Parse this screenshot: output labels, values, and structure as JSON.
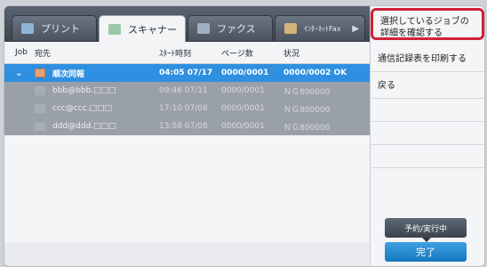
{
  "tabs": [
    {
      "label": "プリント"
    },
    {
      "label": "スキャナー"
    },
    {
      "label": "ファクス"
    },
    {
      "label": "ｲﾝﾀｰﾈｯﾄFax"
    }
  ],
  "table": {
    "headers": {
      "job": "Job",
      "dest": "宛先",
      "time": "ｽﾀｰﾄ時刻",
      "pages": "ページ数",
      "status": "状況"
    },
    "rows": [
      {
        "dest": "順次同報",
        "time": "04:05 07/17",
        "pages": "0000/0001",
        "status": "0000/0002 OK"
      },
      {
        "dest": "bbb@bbb.□□□",
        "time": "09:46 07/11",
        "pages": "0000/0001",
        "status": "ＮＧ800000"
      },
      {
        "dest": "ccc@ccc.□□□",
        "time": "17:10 07/08",
        "pages": "0000/0001",
        "status": "ＮＧ800000"
      },
      {
        "dest": "ddd@ddd.□□□",
        "time": "13:58 07/08",
        "pages": "0000/0001",
        "status": "ＮＧ800000"
      }
    ]
  },
  "panel": {
    "items": [
      {
        "label": "選択しているジョブの詳細を確認する"
      },
      {
        "label": "通信記録表を印刷する"
      },
      {
        "label": "戻る"
      }
    ],
    "buttons": {
      "queue": "予約/実行中",
      "done": "完了"
    }
  },
  "colors": {
    "accent_blue": "#2f8fe0",
    "highlight": "#d0223a"
  }
}
